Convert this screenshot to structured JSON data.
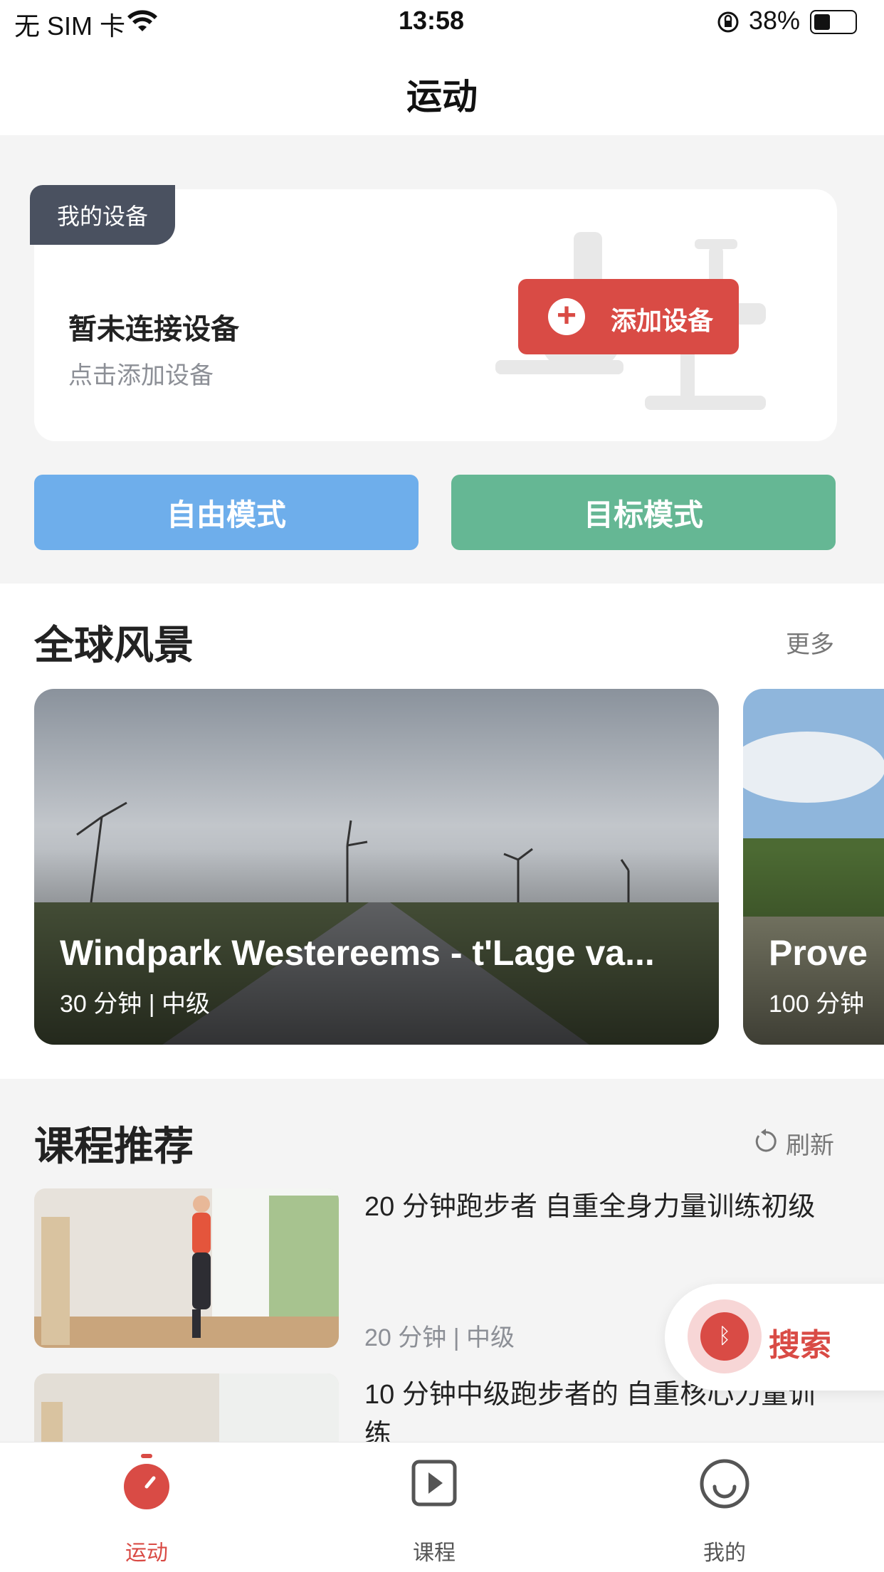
{
  "status_bar": {
    "carrier": "无 SIM 卡",
    "time": "13:58",
    "battery": "38%"
  },
  "nav": {
    "title": "运动"
  },
  "device": {
    "tag": "我的设备",
    "title": "暂未连接设备",
    "subtitle": "点击添加设备",
    "add_label": "添加设备"
  },
  "modes": {
    "free": "自由模式",
    "target": "目标模式"
  },
  "scenery": {
    "title": "全球风景",
    "more": "更多",
    "cards": [
      {
        "title": "Windpark Westereems - t'Lage va...",
        "meta": "30 分钟 | 中级"
      },
      {
        "title": "Prove",
        "meta": "100 分钟"
      }
    ]
  },
  "courses": {
    "title": "课程推荐",
    "refresh": "刷新",
    "items": [
      {
        "title": "20 分钟跑步者 自重全身力量训练初级",
        "meta": "20 分钟 | 中级"
      },
      {
        "title": "10 分钟中级跑步者的 自重核心力量训练",
        "meta": ""
      }
    ]
  },
  "search": {
    "label": "搜索"
  },
  "tabs": [
    {
      "label": "运动",
      "icon": "stopwatch-icon",
      "active": true
    },
    {
      "label": "课程",
      "icon": "play-icon",
      "active": false
    },
    {
      "label": "我的",
      "icon": "smile-icon",
      "active": false
    }
  ],
  "colors": {
    "accent": "#d94b45",
    "free_mode": "#6eaeeb",
    "target_mode": "#65b794",
    "tag_bg": "#4a5160"
  }
}
